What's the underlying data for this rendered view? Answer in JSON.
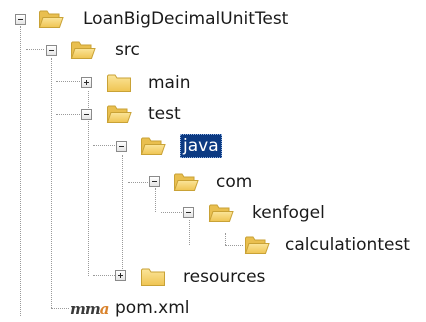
{
  "tree": {
    "root": {
      "label": "LoanBigDecimalUnitTest",
      "expanded": true
    },
    "src": {
      "label": "src",
      "expanded": true
    },
    "main": {
      "label": "main",
      "expanded": false
    },
    "test": {
      "label": "test",
      "expanded": true
    },
    "java": {
      "label": "java",
      "expanded": true,
      "selected": true
    },
    "com": {
      "label": "com",
      "expanded": true
    },
    "kenfogel": {
      "label": "kenfogel",
      "expanded": true
    },
    "calculationtest": {
      "label": "calculationtest"
    },
    "resources": {
      "label": "resources",
      "expanded": false
    },
    "pom": {
      "label": "pom.xml",
      "icon_glyph_m": "m",
      "icon_glyph_a": "a"
    }
  },
  "colors": {
    "folder_fill": "#f3cf69",
    "folder_edge": "#c9a236",
    "selection_bg": "#0c3a82",
    "connector": "#9a9a9a"
  },
  "icons": {
    "folder": "folder-icon",
    "toggle_expanded": "collapse-toggle-icon",
    "toggle_collapsed": "expand-toggle-icon",
    "maven": "maven-pom-icon"
  }
}
